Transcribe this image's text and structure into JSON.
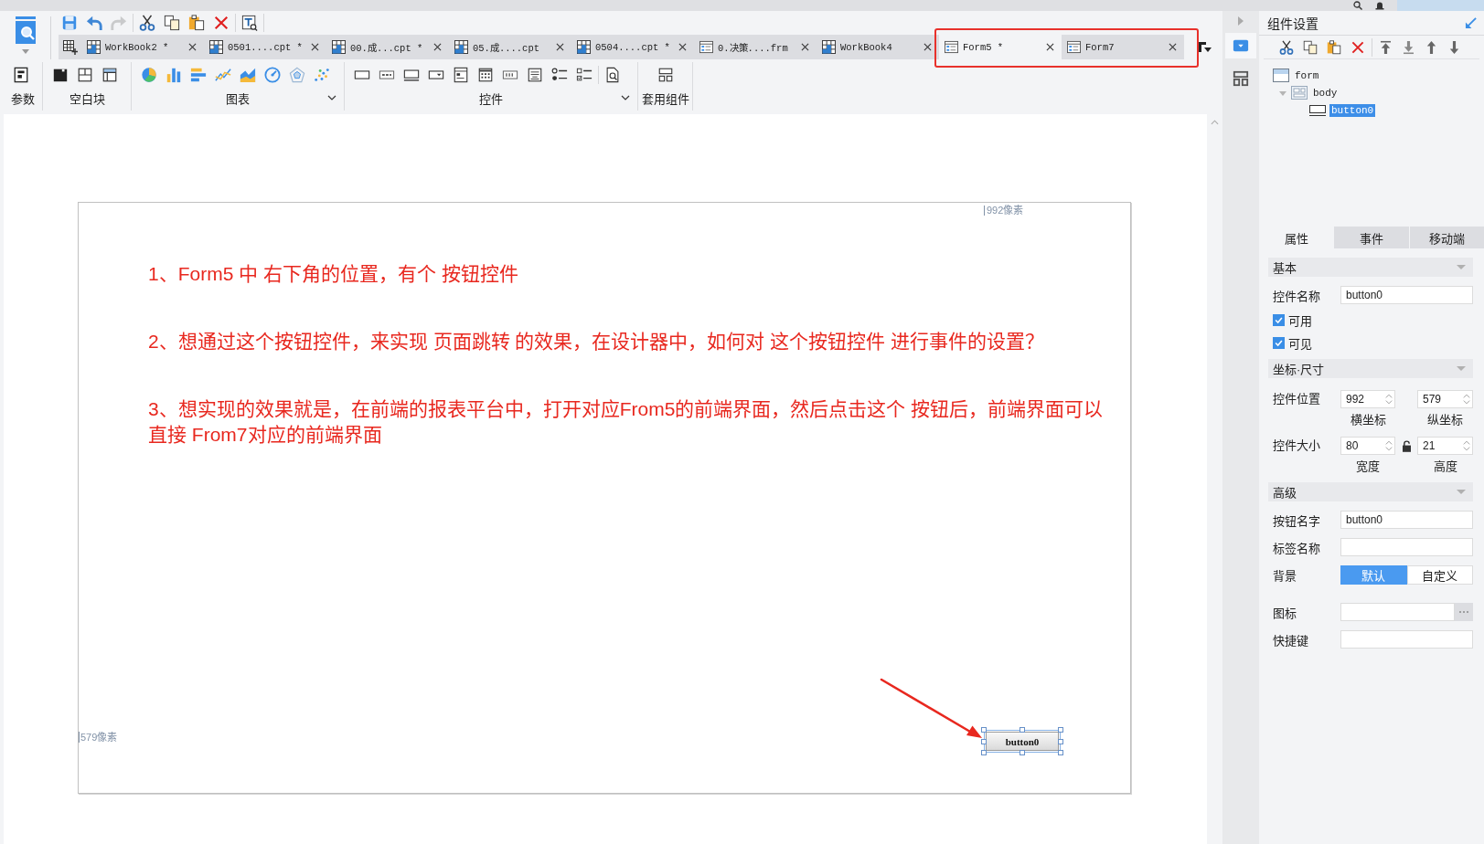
{
  "toolbar": [
    {
      "kind": "save",
      "disabled": false
    },
    {
      "kind": "undo",
      "disabled": false
    },
    {
      "kind": "redo",
      "disabled": true
    },
    {
      "kind": "cut",
      "disabled": false
    },
    {
      "kind": "copy",
      "disabled": false
    },
    {
      "kind": "paste",
      "disabled": false
    },
    {
      "kind": "delete",
      "disabled": false
    },
    {
      "kind": "preview",
      "disabled": false
    }
  ],
  "tabs": [
    {
      "label": "WorkBook2 *",
      "kind": "workbook",
      "selected": false,
      "annotated": false
    },
    {
      "label": "0501....cpt *",
      "kind": "workbook",
      "selected": false,
      "annotated": false
    },
    {
      "label": "00.成...cpt *",
      "kind": "workbook",
      "selected": false,
      "annotated": false
    },
    {
      "label": "05.成....cpt",
      "kind": "workbook",
      "selected": false,
      "annotated": false
    },
    {
      "label": "0504....cpt *",
      "kind": "workbook",
      "selected": false,
      "annotated": false
    },
    {
      "label": "0.决策....frm",
      "kind": "form",
      "selected": false,
      "annotated": false
    },
    {
      "label": "WorkBook4",
      "kind": "workbook",
      "selected": false,
      "annotated": false
    },
    {
      "label": "Form5 *",
      "kind": "form",
      "selected": true,
      "annotated": true
    },
    {
      "label": "Form7",
      "kind": "form",
      "selected": false,
      "annotated": true
    }
  ],
  "ribbon": [
    {
      "label": "参数",
      "kind": "params",
      "menu": false
    },
    {
      "label": "空白块",
      "kind": "blocks",
      "menu": false
    },
    {
      "label": "图表",
      "kind": "charts",
      "menu": true
    },
    {
      "label": "控件",
      "kind": "widgets",
      "menu": true
    },
    {
      "label": "套用组件",
      "kind": "templates",
      "menu": false
    }
  ],
  "canvas": {
    "notes": [
      "1、Form5 中 右下角的位置，有个 按钮控件",
      "2、想通过这个按钮控件，来实现 页面跳转 的效果，在设计器中，如何对 这个按钮控件 进行事件的设置？",
      "3、想实现的效果就是，在前端的报表平台中，打开对应From5的前端界面，然后点击这个 按钮后，前端界面可以直接 From7对应的前端界面"
    ],
    "width_label": "992像素",
    "height_label": "579像素",
    "widget": {
      "label": "button0",
      "selected": true
    }
  },
  "side_tabs": [
    {
      "kind": "widget",
      "selected": true
    },
    {
      "kind": "layout",
      "selected": false
    }
  ],
  "side_panel": {
    "title": "组件设置",
    "tree": [
      {
        "label": "form",
        "kind": "form",
        "selected": false,
        "children": [
          {
            "label": "body",
            "kind": "body",
            "expanded": true,
            "selected": false,
            "children": [
              {
                "label": "button0",
                "kind": "button",
                "selected": true
              }
            ]
          }
        ]
      }
    ],
    "tabs": [
      {
        "label": "属性",
        "selected": true
      },
      {
        "label": "事件",
        "selected": false
      },
      {
        "label": "移动端",
        "selected": false
      }
    ],
    "sections": [
      {
        "title": "基本",
        "rows": [
          {
            "kind": "text",
            "label": "控件名称",
            "value": "button0"
          },
          {
            "kind": "check",
            "label": "可用",
            "checked": true
          },
          {
            "kind": "check",
            "label": "可见",
            "checked": true
          }
        ]
      },
      {
        "title": "坐标·尺寸",
        "rows": [
          {
            "kind": "pair",
            "label": "控件位置",
            "fields": [
              {
                "value": "992",
                "caption": "横坐标"
              },
              {
                "value": "579",
                "caption": "纵坐标"
              }
            ]
          },
          {
            "kind": "pair_lock",
            "label": "控件大小",
            "locked": false,
            "fields": [
              {
                "value": "80",
                "caption": "宽度"
              },
              {
                "value": "21",
                "caption": "高度"
              }
            ]
          }
        ]
      },
      {
        "title": "高级",
        "rows": [
          {
            "kind": "text",
            "label": "按钮名字",
            "value": "button0"
          },
          {
            "kind": "text",
            "label": "标签名称"
          },
          {
            "kind": "toggle",
            "label": "背景",
            "options": [
              {
                "label": "默认",
                "selected": true
              },
              {
                "label": "自定义",
                "selected": false
              }
            ]
          },
          {
            "kind": "picker",
            "label": "图标"
          },
          {
            "kind": "text",
            "label": "快捷键"
          }
        ]
      }
    ]
  }
}
